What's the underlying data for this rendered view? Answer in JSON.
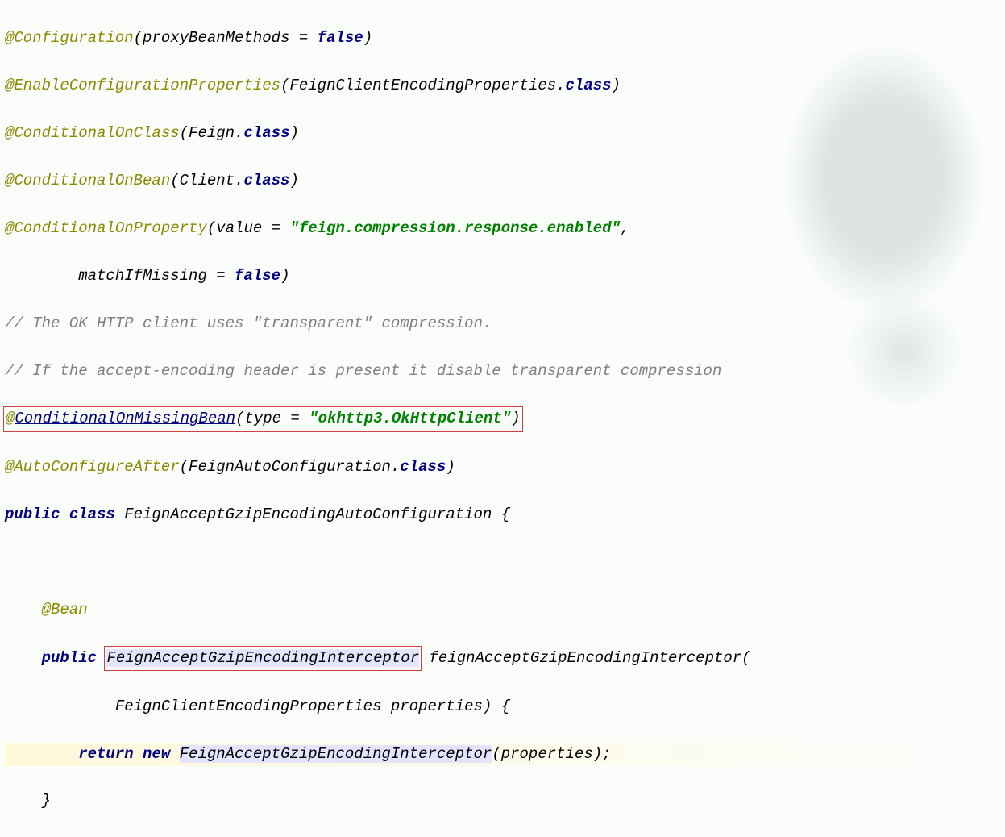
{
  "code": {
    "l1_ann": "@Configuration",
    "l1_rest": "(proxyBeanMethods = ",
    "l1_false": "false",
    "l1_close": ")",
    "l2_ann": "@EnableConfigurationProperties",
    "l2_rest": "(FeignClientEncodingProperties.",
    "l2_class": "class",
    "l2_close": ")",
    "l3_ann": "@ConditionalOnClass",
    "l3_rest": "(Feign.",
    "l3_class": "class",
    "l3_close": ")",
    "l4_ann": "@ConditionalOnBean",
    "l4_rest": "(Client.",
    "l4_class": "class",
    "l4_close": ")",
    "l5_ann": "@ConditionalOnProperty",
    "l5_rest": "(value = ",
    "l5_str": "\"feign.compression.response.enabled\"",
    "l5_close": ",",
    "l6_pre": "        matchIfMissing = ",
    "l6_false": "false",
    "l6_close": ")",
    "l7_com": "// The OK HTTP client uses \"transparent\" compression.",
    "l8_com": "// If the accept-encoding header is present it disable transparent compression",
    "l9_at": "@",
    "l9_link": "ConditionalOnMissingBean",
    "l9_rest": "(type = ",
    "l9_str": "\"okhttp3.OkHttpClient\"",
    "l9_close": ")",
    "l10_ann": "@AutoConfigureAfter",
    "l10_rest": "(FeignAutoConfiguration.",
    "l10_class": "class",
    "l10_close": ")",
    "l11_public": "public ",
    "l11_class": "class ",
    "l11_name": "FeignAcceptGzipEncodingAutoConfiguration {",
    "l12": "",
    "l13_pre": "    ",
    "l13_ann": "@Bean",
    "l14_pre": "    ",
    "l14_public": "public ",
    "l14_type": "FeignAcceptGzipEncodingInterceptor",
    "l14_rest": " feignAcceptGzipEncodingInterceptor(",
    "l15_pre": "            FeignClientEncodingProperties properties) {",
    "l16_pre": "        ",
    "l16_return": "return ",
    "l16_new": "new ",
    "l16_type": "FeignAcceptGzipEncodingInterceptor",
    "l16_rest": "(properties);",
    "l17": "    }"
  }
}
